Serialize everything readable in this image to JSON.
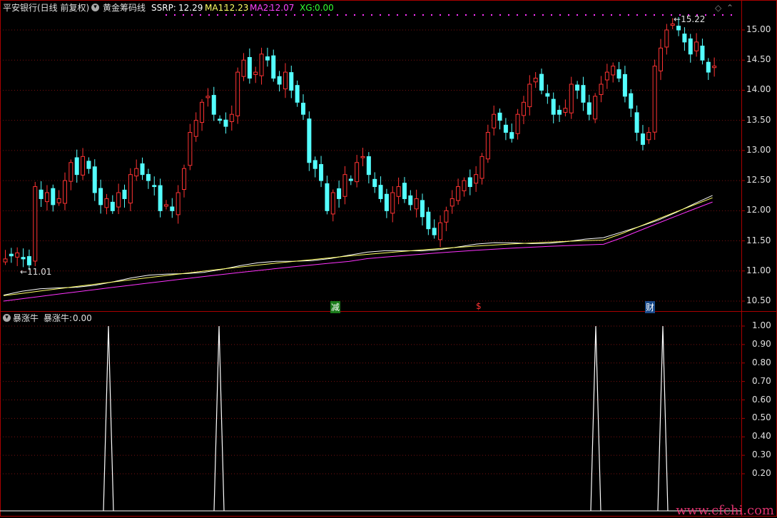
{
  "header": {
    "stock_name": "平安银行(日线 前复权)",
    "indicator_name": "黄金筹码线",
    "ssrp_label": "SSRP:",
    "ssrp_value": "12.29",
    "ma1_label": "MA1:",
    "ma1_value": "12.23",
    "ma2_label": "MA2:",
    "ma2_value": "12.07",
    "xg_label": "XG:",
    "xg_value": "0.00"
  },
  "sub_header": {
    "indicator_name": "暴涨牛",
    "value_label": "暴涨牛:",
    "value": "0.00"
  },
  "price_axis": [
    "15.00",
    "14.50",
    "14.00",
    "13.50",
    "13.00",
    "12.50",
    "12.00",
    "11.50",
    "11.00",
    "10.50"
  ],
  "sub_axis": [
    "1.00",
    "0.90",
    "0.80",
    "0.70",
    "0.60",
    "0.50",
    "0.40",
    "0.30",
    "0.20"
  ],
  "annotations": {
    "high_label": "15.22",
    "low_label": "11.01",
    "marker_1": "减",
    "marker_2": "$",
    "marker_3": "财"
  },
  "watermark": "www.cfchi.com",
  "colors": {
    "up": "#ff3333",
    "down": "#54ffff",
    "ma1": "#ffff66",
    "ssrp": "#ffffff",
    "ma2": "#ff33ff",
    "frame": "#aa0000"
  }
}
